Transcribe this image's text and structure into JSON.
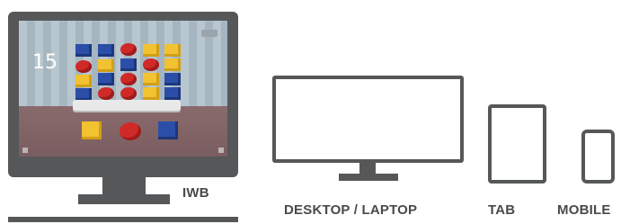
{
  "devices": {
    "iwb": {
      "label": "IWB"
    },
    "desktop": {
      "label": "DESKTOP / LAPTOP"
    },
    "tab": {
      "label": "TAB"
    },
    "mobile": {
      "label": "MOBILE"
    }
  },
  "game_screen": {
    "counter": "15"
  },
  "colors": {
    "device_gray": "#555759",
    "label_gray": "#4a4a4a",
    "block_blue": "#2b4fa8",
    "block_yellow": "#f2c230",
    "block_red": "#d02a28"
  },
  "icons": [
    "iwb-monitor-icon",
    "desktop-monitor-icon",
    "tablet-icon",
    "mobile-phone-icon"
  ]
}
